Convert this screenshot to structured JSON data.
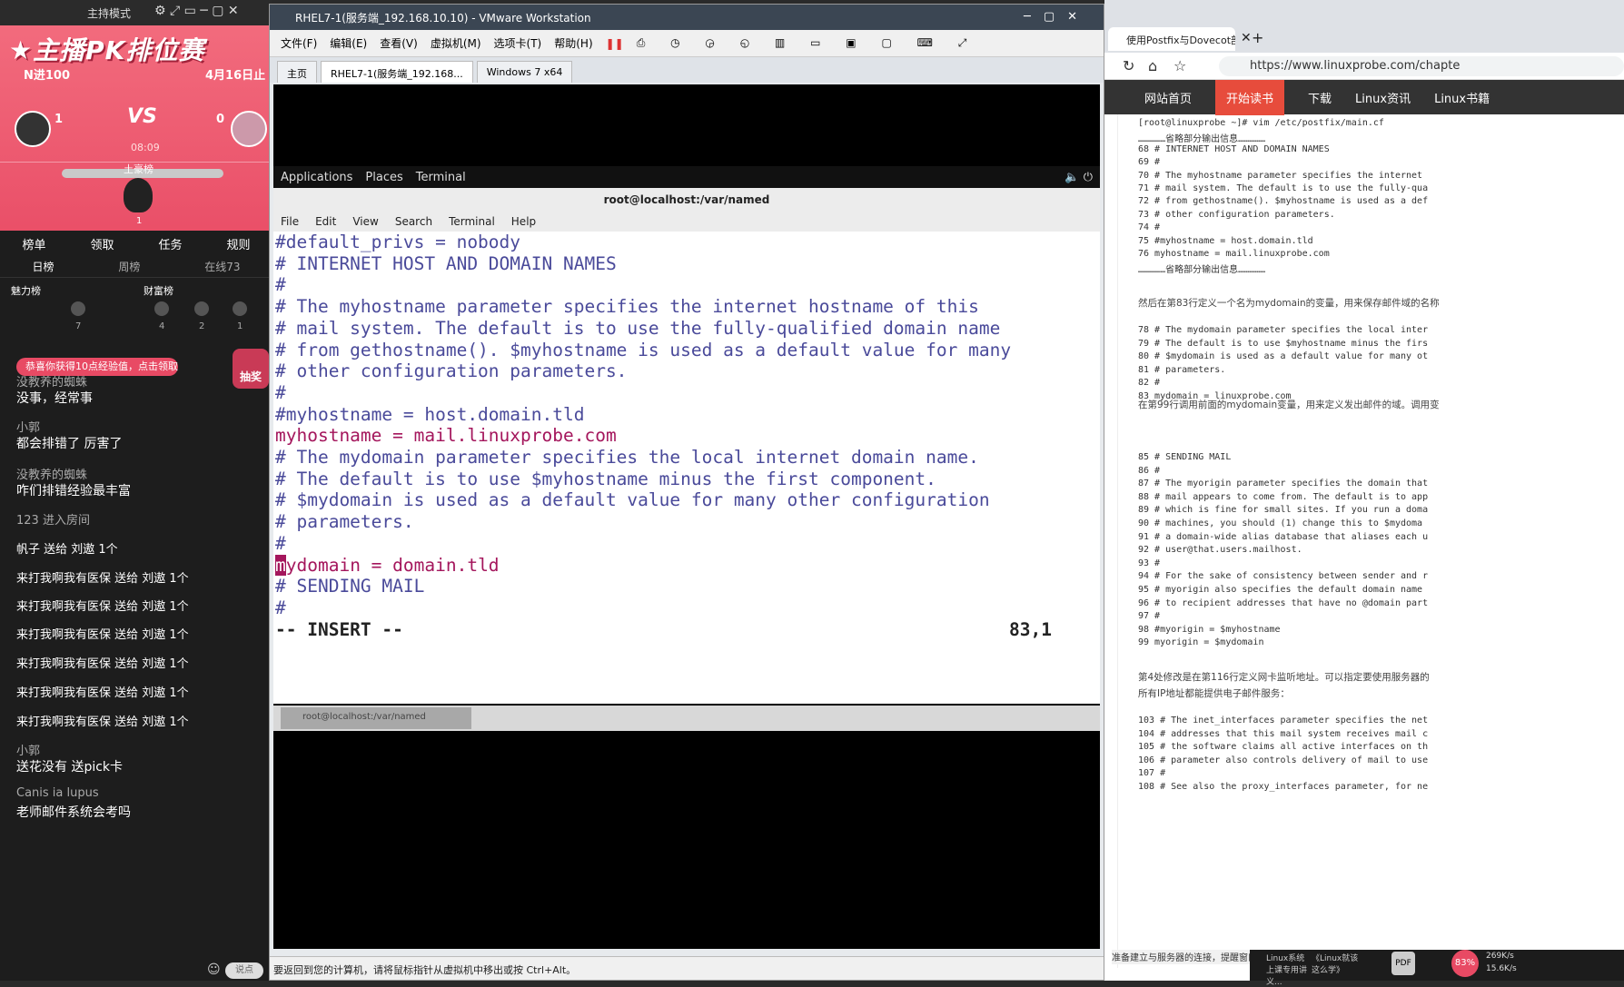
{
  "stream": {
    "mode_label": "主持模式",
    "pk_title": "★主播PK排位赛",
    "pk_round": "N进100",
    "pk_date": "4月16日止",
    "vs": "VS",
    "score_left": "1",
    "score_right": "0",
    "timer": "08:09",
    "rich_label": "土豪榜",
    "rich_count": "1",
    "tabs": [
      "榜单",
      "领取",
      "任务",
      "规则"
    ],
    "subtabs": [
      "日榜",
      "周榜",
      "在线73"
    ],
    "charm_label": "魅力榜",
    "wealth_label": "财富榜",
    "ranks": [
      "7",
      "4",
      "2",
      "1"
    ],
    "notice": "恭喜你获得10点经验值，点击领取",
    "lottery": "抽奖",
    "messages": [
      {
        "user": "没教养的蜘蛛",
        "text": "没事，经常事"
      },
      {
        "user": "小郭",
        "text": "都会排错了 厉害了"
      },
      {
        "user": "没教养的蜘蛛",
        "text": "咋们排错经验最丰富"
      },
      {
        "user": "",
        "text": "123 进入房间"
      },
      {
        "user": "",
        "text": "帆子 送给 刘遨 1个"
      },
      {
        "user": "",
        "text": "来打我啊我有医保 送给 刘遨 1个"
      },
      {
        "user": "",
        "text": "来打我啊我有医保 送给 刘遨 1个"
      },
      {
        "user": "",
        "text": "来打我啊我有医保 送给 刘遨 1个"
      },
      {
        "user": "",
        "text": "来打我啊我有医保 送给 刘遨 1个"
      },
      {
        "user": "",
        "text": "来打我啊我有医保 送给 刘遨 1个"
      },
      {
        "user": "",
        "text": "来打我啊我有医保 送给 刘遨 1个"
      },
      {
        "user": "小郭",
        "text": "送花没有 送pick卡"
      },
      {
        "user": "Canis ia lupus",
        "text": "老师邮件系统会考吗"
      }
    ],
    "input_placeholder": "说点"
  },
  "vmware": {
    "title": "RHEL7-1(服务端_192.168.10.10) - VMware Workstation",
    "menu": [
      "文件(F)",
      "编辑(E)",
      "查看(V)",
      "虚拟机(M)",
      "选项卡(T)",
      "帮助(H)"
    ],
    "tabs": [
      "主页",
      "RHEL7-1(服务端_192.168...",
      "Windows 7 x64"
    ],
    "gnome": [
      "Applications",
      "Places",
      "Terminal"
    ],
    "terminal_title": "root@localhost:/var/named",
    "terminal_menu": [
      "File",
      "Edit",
      "View",
      "Search",
      "Terminal",
      "Help"
    ],
    "lines": [
      "#default_privs = nobody",
      "",
      "# INTERNET HOST AND DOMAIN NAMES",
      "#",
      "# The myhostname parameter specifies the internet hostname of this",
      "# mail system. The default is to use the fully-qualified domain name",
      "# from gethostname(). $myhostname is used as a default value for many",
      "# other configuration parameters.",
      "#",
      "#myhostname = host.domain.tld",
      "myhostname = mail.linuxprobe.com",
      "",
      "# The mydomain parameter specifies the local internet domain name.",
      "# The default is to use $myhostname minus the first component.",
      "# $mydomain is used as a default value for many other configuration",
      "# parameters.",
      "#",
      "mydomain = domain.tld",
      "",
      "# SENDING MAIL",
      "#"
    ],
    "mode": "-- INSERT --",
    "position": "83,1",
    "task_item": "root@localhost:/var/named",
    "status": "要返回到您的计算机，请将鼠标指针从虚拟机中移出或按 Ctrl+Alt。"
  },
  "browser": {
    "tab_title": "使用Postfix与Dovecot部...",
    "url": "https://www.linuxprobe.com/chapte",
    "nav": [
      "网站首页",
      "开始读书",
      "下载",
      "Linux资讯",
      "Linux书籍"
    ],
    "code_block_1": [
      "[root@linuxprobe ~]# vim /etc/postfix/main.cf",
      "……………省略部分输出信息……………",
      "68 # INTERNET HOST AND DOMAIN NAMES",
      "69 #",
      "70 # The myhostname parameter specifies the internet",
      "71 # mail system. The default is to use the fully-qua",
      "72 # from gethostname(). $myhostname is used as a def",
      "73 # other configuration parameters.",
      "74 #",
      "75 #myhostname = host.domain.tld",
      "76 myhostname = mail.linuxprobe.com",
      "……………省略部分输出信息……………"
    ],
    "para_1": "然后在第83行定义一个名为mydomain的变量，用来保存邮件域的名称",
    "code_block_2": [
      "78 # The mydomain parameter specifies the local inter",
      "79 # The default is to use $myhostname minus the firs",
      "80 # $mydomain is used as a default value for many ot",
      "81 # parameters.",
      "82 #",
      "83 mydomain = linuxprobe.com"
    ],
    "para_2": "在第99行调用前面的mydomain变量，用来定义发出邮件的域。调用变",
    "code_block_3": [
      "85 # SENDING MAIL",
      "86 #",
      "87 # The myorigin parameter specifies the domain that",
      "88 # mail appears to come from. The default is to app",
      "89 # which is fine for small sites. If you run a doma",
      "90 # machines, you should (1) change this to $mydoma",
      "91 # a domain-wide alias database that aliases each u",
      "92 # user@that.users.mailhost.",
      "93 #",
      "94 # For the sake of consistency between sender and r",
      "95 # myorigin also specifies the default domain name",
      "96 # to recipient addresses that have no @domain part",
      "97 #",
      "98 #myorigin = $myhostname",
      "99 myorigin = $mydomain"
    ],
    "para_3a": "第4处修改是在第116行定义网卡监听地址。可以指定要使用服务器的",
    "para_3b": "所有IP地址都能提供电子邮件服务：",
    "code_block_4": [
      "103 # The inet_interfaces parameter specifies the net",
      "104 # addresses that this mail system receives mail c",
      "105 # the software claims all active interfaces on th",
      "106 # parameter also controls delivery of mail to use",
      "107 #",
      "108 # See also the proxy_interfaces parameter, for ne"
    ],
    "status": "准备建立与服务器的连接，提醒窗口最小化时，..."
  },
  "tray": {
    "items": [
      "Linux系统上课专用讲义...",
      "《Linux就该这么学》"
    ],
    "net_up": "269K/s",
    "net_down": "15.6K/s",
    "badge": "83%",
    "pdf": "PDF"
  },
  "colors": {
    "pink": "#e84a64",
    "vim_keyword": "#a4165c",
    "nav_active": "#e74c3c"
  }
}
